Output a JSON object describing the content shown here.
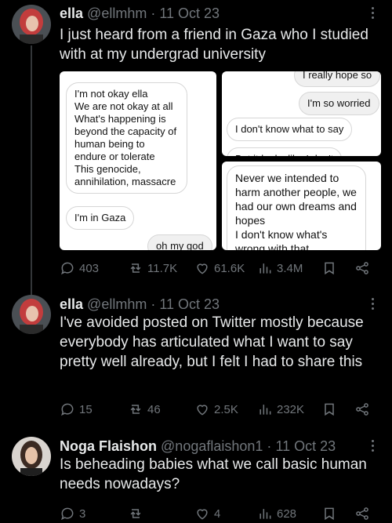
{
  "tweets": [
    {
      "name": "ella",
      "handle": "@ellmhm",
      "dot": "·",
      "date": "11 Oct 23",
      "text": "I just heard from a friend in Gaza who I studied with at my undergrad university",
      "media": {
        "panel1": [
          "I'm not okay ella\nWe are not okay at all\nWhat's happening is beyond the capacity of human being to endure or tolerate\nThis genocide, annihilation, massacre",
          "I'm in Gaza",
          "oh my god"
        ],
        "panel2": [
          "I really hope so",
          "I'm so worried",
          "I don't know what to say",
          "But it looks like I don't"
        ],
        "panel3": [
          "Never we intended to harm another people, we had our own dreams and hopes\nI don't know what's wrong with that"
        ]
      },
      "stats": {
        "replies": "403",
        "retweets": "11.7K",
        "likes": "61.6K",
        "views": "3.4M"
      }
    },
    {
      "name": "ella",
      "handle": "@ellmhm",
      "dot": "·",
      "date": "11 Oct 23",
      "text": "I've avoided posted on Twitter mostly because everybody has articulated what I want to say pretty well already, but I felt I had to share this",
      "stats": {
        "replies": "15",
        "retweets": "46",
        "likes": "2.5K",
        "views": "232K"
      }
    },
    {
      "name": "Noga Flaishon",
      "handle": "@nogaflaishon1",
      "dot": "·",
      "date": "11 Oct 23",
      "text": "Is beheading babies what we call basic human needs nowadays?",
      "stats": {
        "replies": "3",
        "retweets": "",
        "likes": "4",
        "views": "628"
      }
    }
  ],
  "colors": {
    "background": "#000000",
    "text": "#e7e9ea",
    "muted": "#71767b",
    "thread_line": "#333639"
  },
  "icons": [
    "reply-icon",
    "retweet-icon",
    "like-icon",
    "views-icon",
    "bookmark-icon",
    "share-icon",
    "more-icon"
  ]
}
